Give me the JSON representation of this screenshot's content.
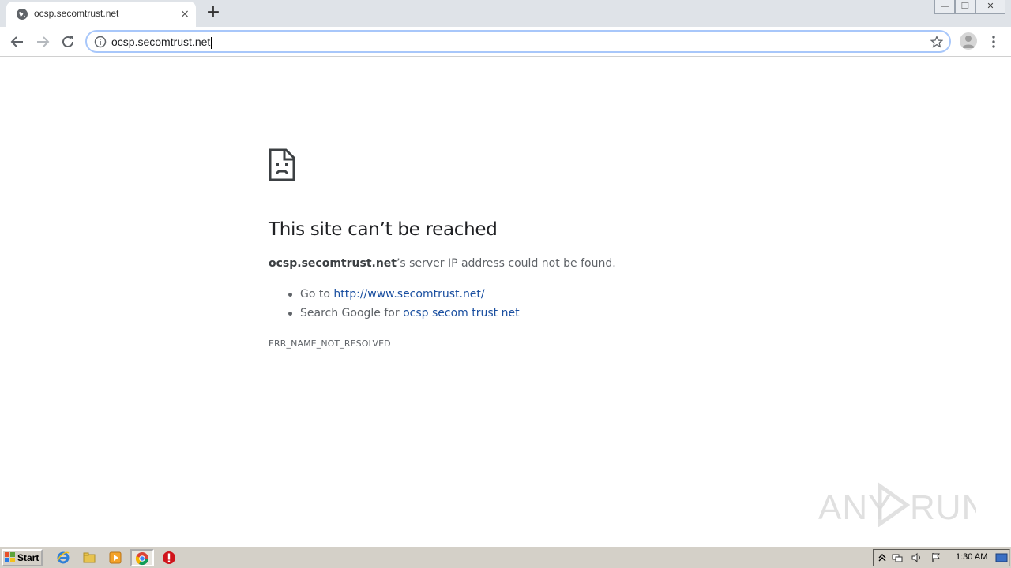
{
  "browser": {
    "tab": {
      "title": "ocsp.secomtrust.net",
      "close_glyph": "×",
      "favicon": "globe-icon"
    },
    "new_tab_glyph": "+",
    "window_controls": {
      "minimize": "—",
      "maximize": "❐",
      "close": "✕"
    },
    "omnibox": {
      "url": "ocsp.secomtrust.net",
      "info_icon": "info-icon",
      "star_icon": "star-icon"
    }
  },
  "error_page": {
    "title": "This site can’t be reached",
    "description_host": "ocsp.secomtrust.net",
    "description_rest": "’s server IP address could not be found.",
    "suggestions": [
      {
        "prefix": "Go to ",
        "link": "http://www.secomtrust.net/"
      },
      {
        "prefix": "Search Google for ",
        "link": "ocsp secom trust net"
      }
    ],
    "error_code": "ERR_NAME_NOT_RESOLVED"
  },
  "watermark": {
    "text": "ANY RUN"
  },
  "taskbar": {
    "start_label": "Start",
    "pinned": [
      "internet-explorer-icon",
      "folder-icon",
      "media-player-icon",
      "chrome-icon",
      "stop-icon"
    ],
    "clock": "1:30 AM"
  },
  "colors": {
    "link": "#1a4fa0",
    "title": "#202124",
    "text": "#5f6368",
    "tabstrip": "#dfe3e8",
    "taskbar": "#d4d0c8"
  }
}
